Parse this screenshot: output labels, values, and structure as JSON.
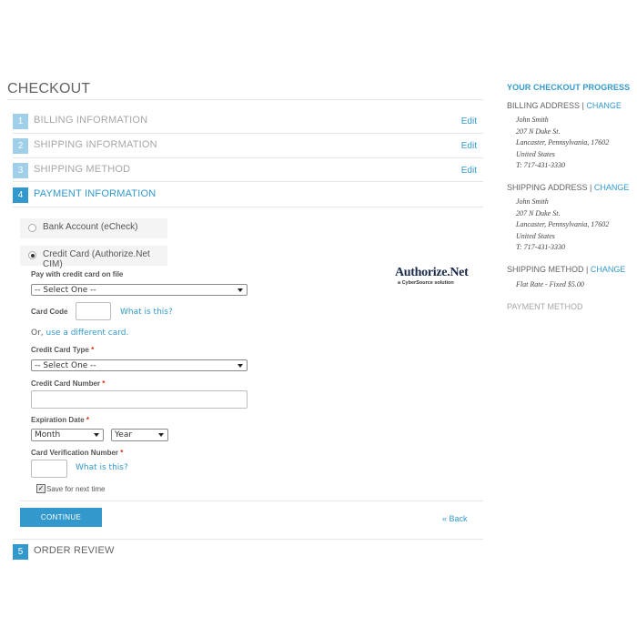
{
  "page_title": "CHECKOUT",
  "steps": [
    {
      "num": "1",
      "label": "BILLING INFORMATION",
      "edit": "Edit"
    },
    {
      "num": "2",
      "label": "SHIPPING INFORMATION",
      "edit": "Edit"
    },
    {
      "num": "3",
      "label": "SHIPPING METHOD",
      "edit": "Edit"
    },
    {
      "num": "4",
      "label": "PAYMENT INFORMATION"
    },
    {
      "num": "5",
      "label": "ORDER REVIEW"
    }
  ],
  "payment": {
    "methods": [
      {
        "label": "Bank Account (eCheck)",
        "selected": false
      },
      {
        "label": "Credit Card (Authorize.Net CIM)",
        "selected": true
      }
    ],
    "logo_text": "Authorize.Net",
    "logo_subtext": "a CyberSource solution",
    "pay_with_label": "Pay with credit card on file",
    "pay_with_value": "-- Select One --",
    "card_code_label": "Card Code",
    "what_is_this": "What is this?",
    "or_text": "Or,",
    "different_card_link": "use a different card.",
    "cc_type_label": "Credit Card Type",
    "cc_type_value": "-- Select One --",
    "cc_number_label": "Credit Card Number",
    "exp_label": "Expiration Date",
    "month_value": "Month",
    "year_value": "Year",
    "cvv_label": "Card Verification Number",
    "required_mark": "*",
    "save_label": "Save for next time",
    "save_checked": true,
    "continue_label": "CONTINUE",
    "back_label": "« Back"
  },
  "sidebar": {
    "heading": "YOUR CHECKOUT PROGRESS",
    "change_label": "CHANGE",
    "separator": " | ",
    "billing": {
      "title": "BILLING ADDRESS",
      "lines": [
        "John Smith",
        "207 N Duke St.",
        "Lancaster, Pennsylvania, 17602",
        "United States",
        "T: 717-431-3330"
      ]
    },
    "shipping": {
      "title": "SHIPPING ADDRESS",
      "lines": [
        "John Smith",
        "207 N Duke St.",
        "Lancaster, Pennsylvania, 17602",
        "United States",
        "T: 717-431-3330"
      ]
    },
    "method": {
      "title": "SHIPPING METHOD",
      "value": "Flat Rate - Fixed $5.00"
    },
    "payment_title": "PAYMENT METHOD"
  },
  "colors": {
    "accent": "#3399cc",
    "inactive_step": "#9fcfe9",
    "required": "#df280a"
  }
}
